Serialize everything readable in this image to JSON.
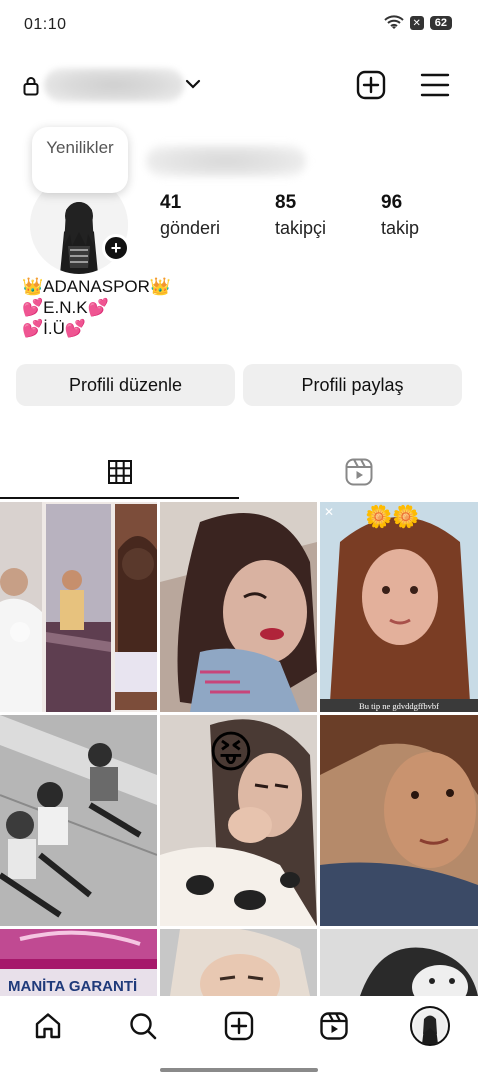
{
  "status_bar": {
    "time": "01:10",
    "battery": "62",
    "notification_glyph": "✕"
  },
  "profile": {
    "note_text": "Yenilikler",
    "add_story_glyph": "+",
    "stats": [
      {
        "count": "41",
        "label": "gönderi"
      },
      {
        "count": "85",
        "label": "takipçi"
      },
      {
        "count": "96",
        "label": "takip"
      }
    ],
    "bio_lines": [
      "👑ADANASPOR👑",
      "💕E.N.K💕",
      "💕İ.Ü💕"
    ]
  },
  "buttons": {
    "edit_profile": "Profili düzenle",
    "share_profile": "Profili paylaş"
  },
  "grid": {
    "caption_overlay": "Bu tip ne gdvddgffbvbf",
    "store_sign": "MANİTA GARANTİ",
    "sticker_emoji": "😝",
    "flower_stickers": "🌼🌼"
  },
  "icons": {
    "lock": "lock-icon",
    "dropdown": "chevron-down-icon",
    "create": "plus-square-icon",
    "menu": "menu-icon",
    "grid_tab": "grid-icon",
    "reels_tab": "reels-icon",
    "home": "home-icon",
    "search": "search-icon",
    "reels_nav": "reels-icon",
    "profile_nav": "avatar"
  },
  "colors": {
    "accent": "#111111",
    "button_bg": "#efefef",
    "caption_bar": "#3a3a3a"
  }
}
